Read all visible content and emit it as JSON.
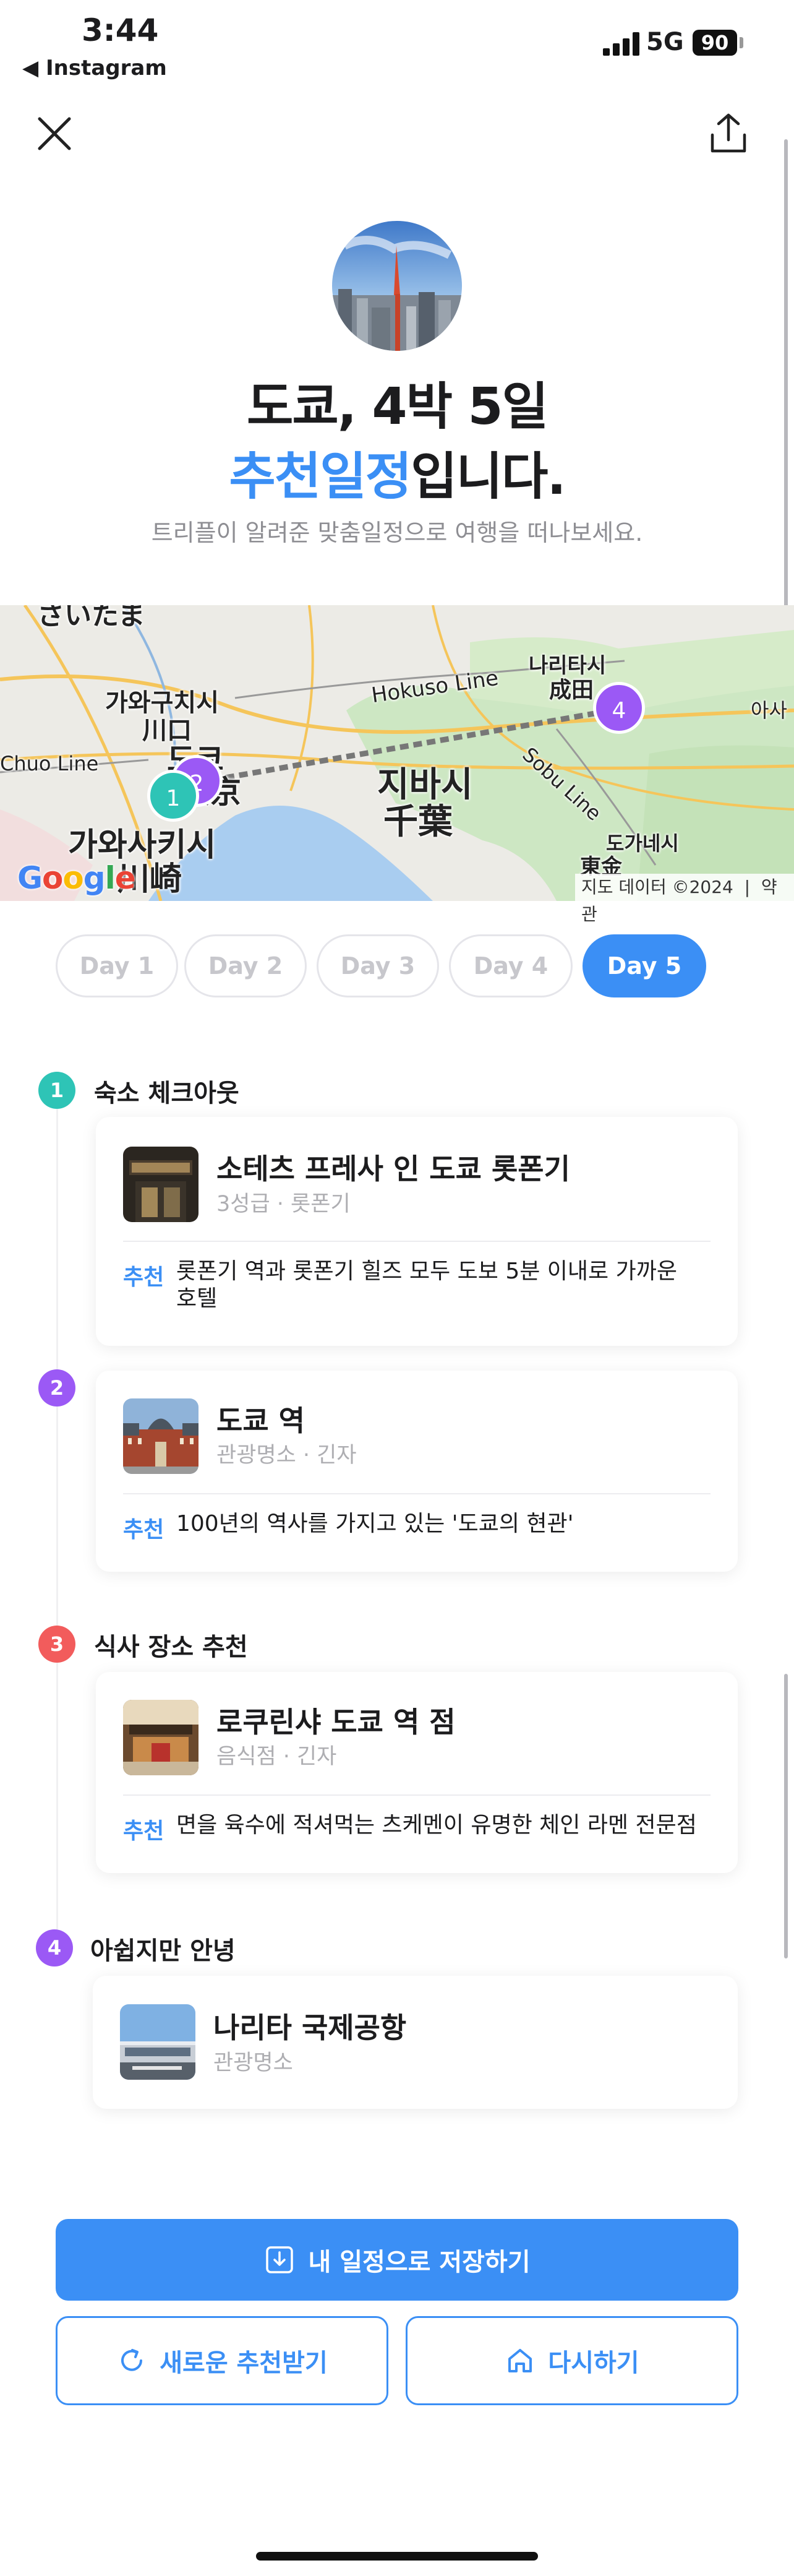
{
  "status_bar": {
    "time": "3:44",
    "back_app": "◀ Instagram",
    "network": "5G",
    "battery": "90"
  },
  "hero": {
    "title_line1": "도쿄, 4박 5일",
    "title_accent": "추천일정",
    "title_suffix": "입니다.",
    "subtitle": "트리플이 알려준 맞춤일정으로 여행을 떠나보세요."
  },
  "map": {
    "labels": [
      "가와구치시",
      "川口",
      "도쿄",
      "東京",
      "가와사키시",
      "川崎",
      "지바시",
      "千葉",
      "나리타시",
      "成田",
      "도가네시",
      "東金",
      "Hokuso Line",
      "Sobu Line",
      "Chuo Line",
      "아사",
      "さいたま"
    ],
    "pins": [
      "1",
      "2",
      "4"
    ],
    "google": "Google",
    "credit": "지도 데이터 ©2024",
    "terms": "약관"
  },
  "tabs": [
    {
      "label": "Day 1",
      "active": false
    },
    {
      "label": "Day 2",
      "active": false
    },
    {
      "label": "Day 3",
      "active": false
    },
    {
      "label": "Day 4",
      "active": false
    },
    {
      "label": "Day 5",
      "active": true
    }
  ],
  "schedule": [
    {
      "num": "1",
      "title": "숙소 체크아웃",
      "color": "#2ec4b6",
      "place": "소테츠 프레사 인 도쿄 롯폰기",
      "meta": "3성급 · 롯폰기",
      "rec_label": "추천",
      "rec_line1": "롯폰기 역과 롯폰기 힐즈 모두 도보 5분 이내로 가까운",
      "rec_line2": "호텔"
    },
    {
      "num": "2",
      "title": "",
      "color": "#9b59f5",
      "place": "도쿄 역",
      "meta": "관광명소 · 긴자",
      "rec_label": "추천",
      "rec_line1": "100년의 역사를 가지고 있는 '도쿄의 현관'"
    },
    {
      "num": "3",
      "title": "식사 장소 추천",
      "color": "#f25c5c",
      "place": "로쿠린샤 도쿄 역 점",
      "meta": "음식점 · 긴자",
      "rec_label": "추천",
      "rec_line1": "면을 육수에 적셔먹는 츠케멘이 유명한 체인 라멘 전문점"
    },
    {
      "num": "4",
      "title": "아쉽지만 안녕",
      "color": "#9b59f5",
      "place": "나리타 국제공항",
      "meta": "관광명소"
    }
  ],
  "buttons": {
    "save": "내 일정으로 저장하기",
    "renew": "새로운 추천받기",
    "retry": "다시하기"
  },
  "colors": {
    "accent": "#3b8ff5",
    "teal": "#2ec4b6",
    "purple": "#9b59f5",
    "red": "#f25c5c"
  }
}
